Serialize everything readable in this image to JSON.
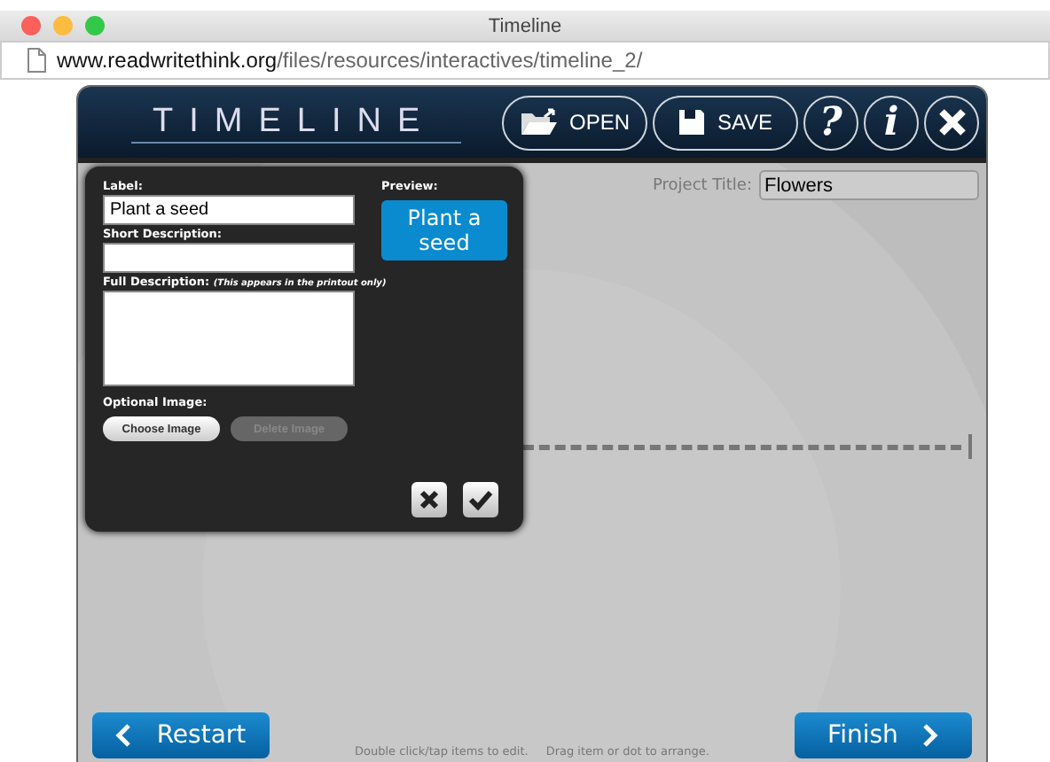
{
  "window": {
    "title": "Timeline",
    "url_domain": "www.readwritethink.org",
    "url_path": "/files/resources/interactives/timeline_2/"
  },
  "app": {
    "logo": "TIMELINE",
    "toolbar": [
      {
        "kind": "open",
        "label": "OPEN"
      },
      {
        "kind": "save",
        "label": "SAVE"
      },
      {
        "kind": "glyph",
        "label": "?"
      },
      {
        "kind": "glyph",
        "label": "i"
      },
      {
        "kind": "close"
      }
    ]
  },
  "project_title": {
    "label": "Project Title:",
    "value": "Flowers"
  },
  "editor": {
    "label_field": {
      "label": "Label:",
      "value": "Plant a seed"
    },
    "short_description": {
      "label": "Short Description:"
    },
    "full_description": {
      "label": "Full Description:",
      "note": "(This appears in the printout only)"
    },
    "preview": {
      "label": "Preview:",
      "text": "Plant a seed"
    },
    "optional_image": {
      "label": "Optional Image:",
      "buttons": [
        {
          "label": "Choose Image",
          "disabled": false
        },
        {
          "label": "Delete Image",
          "disabled": true
        }
      ]
    }
  },
  "footer": {
    "restart": "Restart",
    "finish": "Finish",
    "hints": [
      "Double click/tap items to edit.",
      "Drag item or dot to arrange."
    ]
  }
}
